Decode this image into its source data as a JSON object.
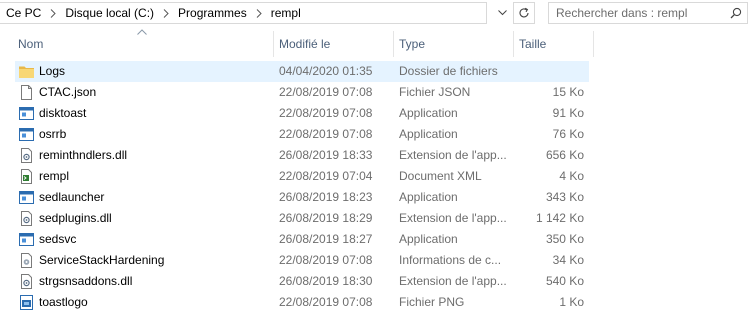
{
  "address": {
    "breadcrumbs": [
      "Ce PC",
      "Disque local (C:)",
      "Programmes",
      "rempl"
    ],
    "dropdown_icon": "chevron-down-icon",
    "refresh_icon": "refresh-icon"
  },
  "search": {
    "placeholder": "Rechercher dans : rempl",
    "icon": "search-icon"
  },
  "columns": {
    "name": "Nom",
    "date": "Modifié le",
    "type": "Type",
    "size": "Taille",
    "sort_icon": "sort-up-icon"
  },
  "files": [
    {
      "name": "Logs",
      "date": "04/04/2020 01:35",
      "type": "Dossier de fichiers",
      "size": "",
      "icon": "folder-icon",
      "selected": true
    },
    {
      "name": "CTAC.json",
      "date": "22/08/2019 07:08",
      "type": "Fichier JSON",
      "size": "15 Ko",
      "icon": "file-icon"
    },
    {
      "name": "disktoast",
      "date": "22/08/2019 07:08",
      "type": "Application",
      "size": "91 Ko",
      "icon": "application-icon"
    },
    {
      "name": "osrrb",
      "date": "22/08/2019 07:08",
      "type": "Application",
      "size": "76 Ko",
      "icon": "application-icon"
    },
    {
      "name": "reminthndlers.dll",
      "date": "26/08/2019 18:33",
      "type": "Extension de l'app...",
      "size": "656 Ko",
      "icon": "dll-icon"
    },
    {
      "name": "rempl",
      "date": "22/08/2019 07:04",
      "type": "Document XML",
      "size": "4 Ko",
      "icon": "xml-icon"
    },
    {
      "name": "sedlauncher",
      "date": "26/08/2019 18:23",
      "type": "Application",
      "size": "343 Ko",
      "icon": "application-icon"
    },
    {
      "name": "sedplugins.dll",
      "date": "26/08/2019 18:29",
      "type": "Extension de l'app...",
      "size": "1 142 Ko",
      "icon": "dll-icon"
    },
    {
      "name": "sedsvc",
      "date": "26/08/2019 18:27",
      "type": "Application",
      "size": "350 Ko",
      "icon": "application-icon"
    },
    {
      "name": "ServiceStackHardening",
      "date": "22/08/2019 07:08",
      "type": "Informations de c...",
      "size": "34 Ko",
      "icon": "settings-file-icon"
    },
    {
      "name": "strgsnsaddons.dll",
      "date": "26/08/2019 18:30",
      "type": "Extension de l'app...",
      "size": "540 Ko",
      "icon": "dll-icon"
    },
    {
      "name": "toastlogo",
      "date": "22/08/2019 07:08",
      "type": "Fichier PNG",
      "size": "1 Ko",
      "icon": "image-file-icon"
    }
  ],
  "colors": {
    "selected_row": "#e5f3ff",
    "header_text": "#4c607a",
    "secondary_text": "#6d6d6d",
    "folder": "#f8d775",
    "border": "#d9d9d9"
  }
}
